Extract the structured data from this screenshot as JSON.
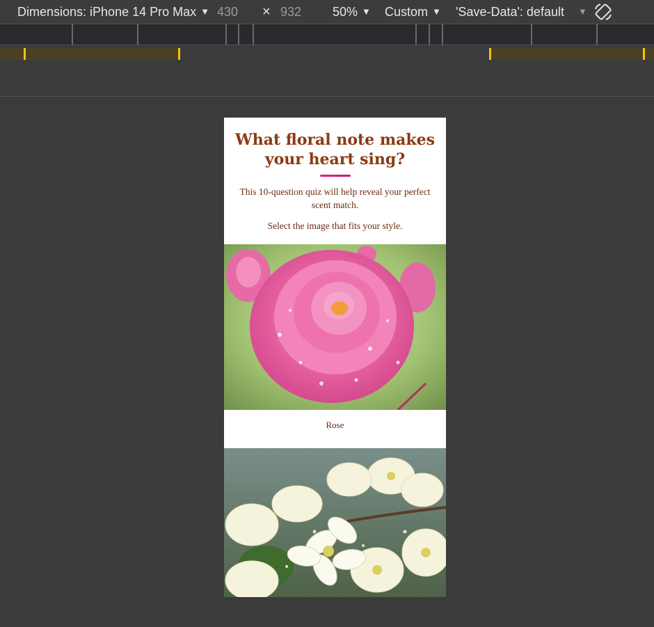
{
  "devtools": {
    "dimensions_label": "Dimensions: iPhone 14 Pro Max",
    "width_value": "430",
    "times_symbol": "×",
    "height_value": "932",
    "zoom_label": "50%",
    "throttle_label": "Custom",
    "save_data_label": "'Save-Data': default",
    "icons": {
      "dropdown": "caret-down-icon",
      "rotate": "rotate-device-icon"
    },
    "colors": {
      "toolbar_bg": "#3c3c3c",
      "query_marker": "#f4c20d"
    }
  },
  "quiz": {
    "title": "What floral note makes your heart sing?",
    "intro": "This 10-question quiz will help reveal your perfect scent match.",
    "instruction": "Select the image that fits your style.",
    "options": [
      {
        "label": "Rose",
        "image": "pink-rose-photo"
      },
      {
        "label": "",
        "image": "white-jasmine-photo"
      }
    ],
    "colors": {
      "title": "#8b3a14",
      "accent": "#e5208a",
      "text": "#6b2b10"
    }
  }
}
